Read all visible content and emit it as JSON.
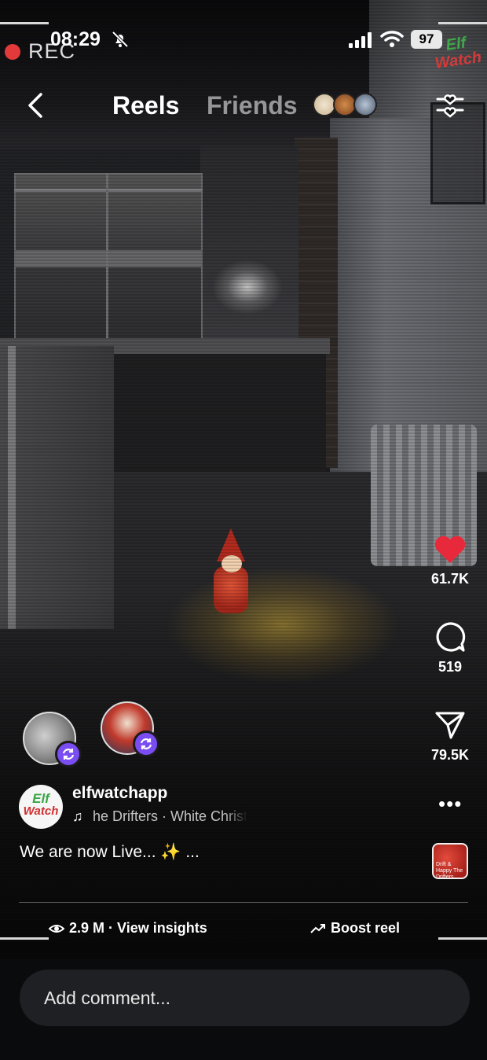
{
  "status_bar": {
    "rec_label": "REC",
    "time": "08:29",
    "battery": "97",
    "icons": [
      "mute-bell-icon",
      "signal-icon",
      "wifi-icon"
    ]
  },
  "watermark": {
    "line1": "Elf",
    "line2": "Watch"
  },
  "nav": {
    "back_icon": "chevron-left-icon",
    "tabs": [
      {
        "label": "Reels",
        "active": true
      },
      {
        "label": "Friends",
        "active": false
      }
    ],
    "filter_icon": "sliders-heart-icon"
  },
  "actions": {
    "like": {
      "icon": "heart-filled-icon",
      "count": "61.7K",
      "color": "#e8293b"
    },
    "comment": {
      "icon": "speech-bubble-icon",
      "count": "519"
    },
    "share": {
      "icon": "paper-plane-icon",
      "count": "79.5K"
    }
  },
  "collaborators": [
    {
      "icon": "refresh-badge-icon"
    },
    {
      "icon": "refresh-badge-icon"
    }
  ],
  "post": {
    "avatar_line1": "Elf",
    "avatar_line2": "Watch",
    "username": "elfwatchapp",
    "music": "he Drifters · White Christ",
    "caption": "We are now Live... ✨ ...",
    "more_label": "•••",
    "album_art_text": "Drift & Happy The Drifters"
  },
  "footer": {
    "views": "2.9 M · View insights",
    "boost": "Boost reel"
  },
  "comment_box": {
    "placeholder": "Add comment..."
  },
  "colors": {
    "accent_purple": "#7a4df2",
    "like_red": "#e8293b",
    "rec_red": "#e23a3a"
  }
}
